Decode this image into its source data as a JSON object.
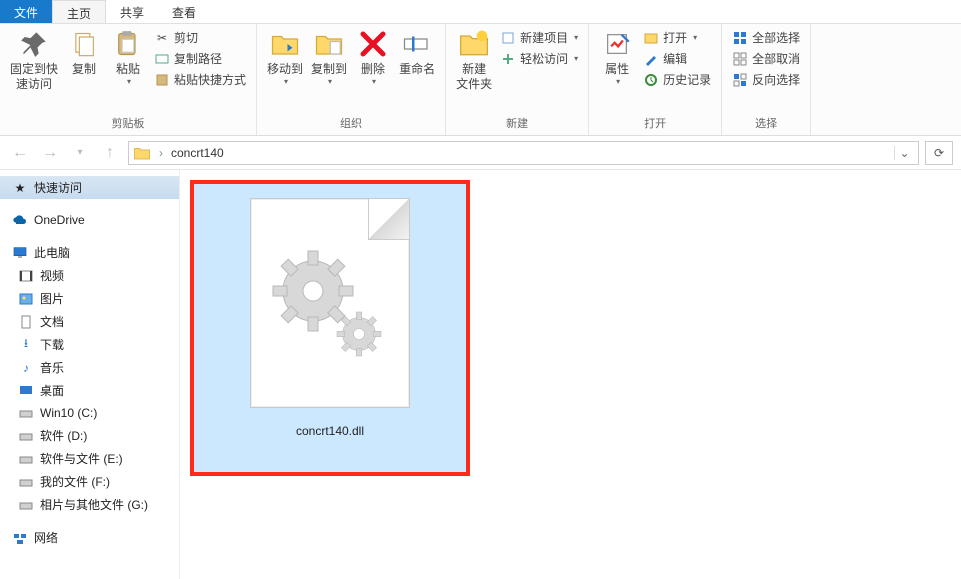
{
  "tabs": {
    "file": "文件",
    "home": "主页",
    "share": "共享",
    "view": "查看"
  },
  "ribbon": {
    "clipboard": {
      "pin": "固定到快\n速访问",
      "copy": "复制",
      "paste": "粘贴",
      "cut": "剪切",
      "copypath": "复制路径",
      "pasteshortcut": "粘贴快捷方式",
      "label": "剪贴板"
    },
    "organize": {
      "moveto": "移动到",
      "copyto": "复制到",
      "delete": "删除",
      "rename": "重命名",
      "label": "组织"
    },
    "new": {
      "newfolder": "新建\n文件夹",
      "newitem": "新建项目",
      "easyaccess": "轻松访问",
      "label": "新建"
    },
    "open": {
      "properties": "属性",
      "open": "打开",
      "edit": "编辑",
      "history": "历史记录",
      "label": "打开"
    },
    "select": {
      "all": "全部选择",
      "none": "全部取消",
      "invert": "反向选择",
      "label": "选择"
    }
  },
  "address": {
    "folder": "concrt140"
  },
  "nav": {
    "quick": "快速访问",
    "onedrive": "OneDrive",
    "thispc": "此电脑",
    "video": "视频",
    "pictures": "图片",
    "documents": "文档",
    "downloads": "下载",
    "music": "音乐",
    "desktop": "桌面",
    "drive_c": "Win10 (C:)",
    "drive_d": "软件 (D:)",
    "drive_e": "软件与文件 (E:)",
    "drive_f": "我的文件 (F:)",
    "drive_g": "相片与其他文件 (G:)",
    "network": "网络"
  },
  "file": {
    "name": "concrt140.dll"
  }
}
